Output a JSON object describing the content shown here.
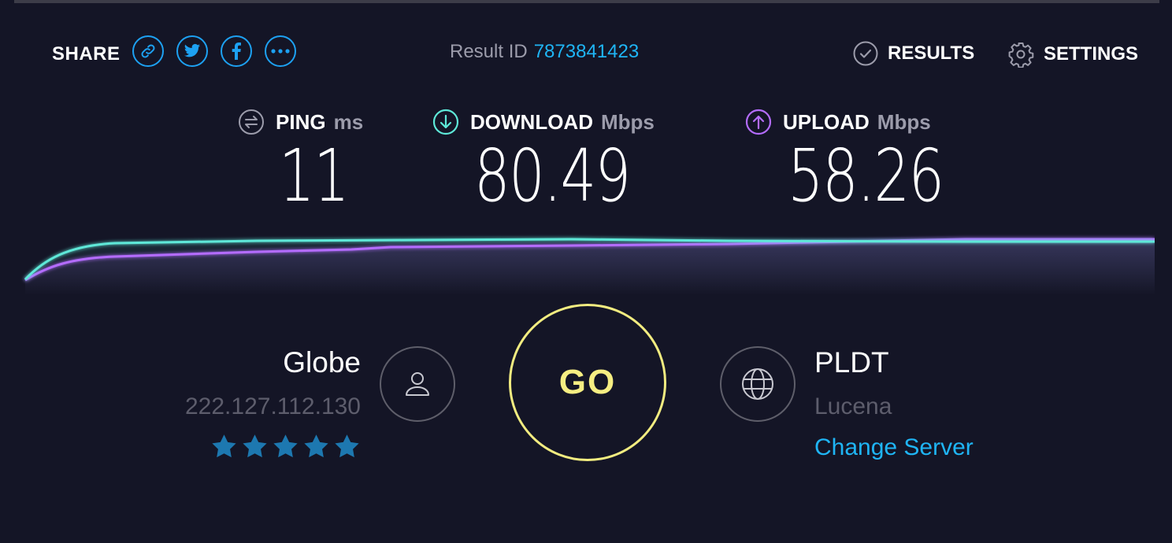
{
  "header": {
    "share_label": "SHARE",
    "share_buttons": [
      {
        "icon": "link-icon"
      },
      {
        "icon": "twitter-icon"
      },
      {
        "icon": "facebook-icon"
      },
      {
        "icon": "more-icon"
      }
    ],
    "result_id_label": "Result ID",
    "result_id_value": "7873841423",
    "results_label": "RESULTS",
    "settings_label": "SETTINGS"
  },
  "metrics": {
    "ping": {
      "label": "PING",
      "unit": "ms",
      "value": "11",
      "icon": "ping-icon"
    },
    "download": {
      "label": "DOWNLOAD",
      "unit": "Mbps",
      "value": "80.49",
      "icon": "download-icon"
    },
    "upload": {
      "label": "UPLOAD",
      "unit": "Mbps",
      "value": "58.26",
      "icon": "upload-icon"
    }
  },
  "isp": {
    "name": "Globe",
    "ip": "222.127.112.130",
    "rating_stars": 5,
    "icon": "user-icon"
  },
  "go_label": "GO",
  "server": {
    "name": "PLDT",
    "location": "Lucena",
    "change_label": "Change Server",
    "icon": "globe-icon"
  },
  "colors": {
    "background": "#141526",
    "accent_blue": "#1fb5f5",
    "download_teal": "#5ee8d8",
    "upload_purple": "#b46cff",
    "go_yellow": "#f6ee82",
    "muted_text": "#9c9cab"
  }
}
